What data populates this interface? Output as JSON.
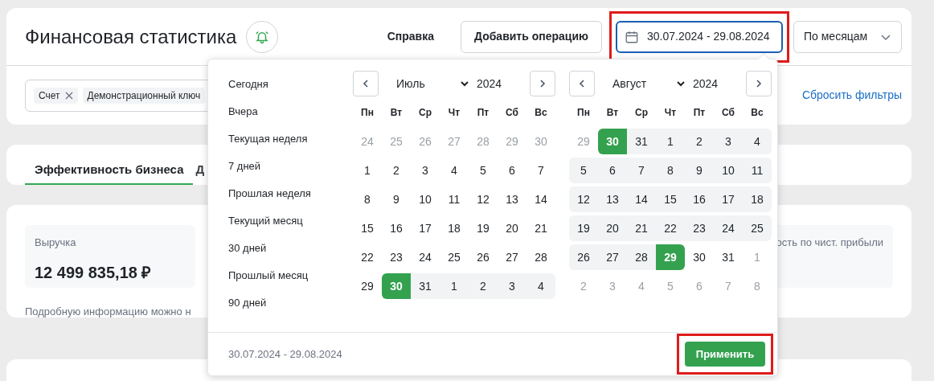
{
  "header": {
    "title": "Финансовая статистика",
    "help_link": "Справка",
    "add_button": "Добавить операцию",
    "date_field": {
      "value": "30.07.2024 - 29.08.2024",
      "focused": true,
      "highlighted": true
    },
    "grouping_select": {
      "value": "По месяцам"
    }
  },
  "filters": {
    "chips": [
      {
        "label": "Счет",
        "removable": true
      },
      {
        "label": "Демонстрационный ключ",
        "removable": false
      }
    ],
    "reset_link": "Сбросить фильтры"
  },
  "tabs": [
    {
      "label": "Эффективность бизнеса",
      "selected": true
    },
    {
      "label": "Д",
      "selected": false
    }
  ],
  "metrics": [
    {
      "label": "Выручка",
      "value": "12 499 835,18 ₽"
    },
    {
      "label": "ость по чист. прибыли"
    }
  ],
  "note": "Подробную информацию можно н",
  "date_picker": {
    "presets": [
      "Сегодня",
      "Вчера",
      "Текущая неделя",
      "7 дней",
      "Прошлая неделя",
      "Текущий месяц",
      "30 дней",
      "Прошлый месяц",
      "90 дней"
    ],
    "calendars": [
      {
        "month": "Июль",
        "year": "2024",
        "weekdays": [
          "Пн",
          "Вт",
          "Ср",
          "Чт",
          "Пт",
          "Сб",
          "Вс"
        ],
        "weeks": [
          [
            {
              "day": "24",
              "muted": true,
              "in_range": false,
              "selected": false
            },
            {
              "day": "25",
              "muted": true,
              "in_range": false,
              "selected": false
            },
            {
              "day": "26",
              "muted": true,
              "in_range": false,
              "selected": false
            },
            {
              "day": "27",
              "muted": true,
              "in_range": false,
              "selected": false
            },
            {
              "day": "28",
              "muted": true,
              "in_range": false,
              "selected": false
            },
            {
              "day": "29",
              "muted": true,
              "in_range": false,
              "selected": false
            },
            {
              "day": "30",
              "muted": true,
              "in_range": false,
              "selected": false
            }
          ],
          [
            {
              "day": "1",
              "muted": false,
              "in_range": false,
              "selected": false
            },
            {
              "day": "2",
              "muted": false,
              "in_range": false,
              "selected": false
            },
            {
              "day": "3",
              "muted": false,
              "in_range": false,
              "selected": false
            },
            {
              "day": "4",
              "muted": false,
              "in_range": false,
              "selected": false
            },
            {
              "day": "5",
              "muted": false,
              "in_range": false,
              "selected": false
            },
            {
              "day": "6",
              "muted": false,
              "in_range": false,
              "selected": false
            },
            {
              "day": "7",
              "muted": false,
              "in_range": false,
              "selected": false
            }
          ],
          [
            {
              "day": "8",
              "muted": false,
              "in_range": false,
              "selected": false
            },
            {
              "day": "9",
              "muted": false,
              "in_range": false,
              "selected": false
            },
            {
              "day": "10",
              "muted": false,
              "in_range": false,
              "selected": false
            },
            {
              "day": "11",
              "muted": false,
              "in_range": false,
              "selected": false
            },
            {
              "day": "12",
              "muted": false,
              "in_range": false,
              "selected": false
            },
            {
              "day": "13",
              "muted": false,
              "in_range": false,
              "selected": false
            },
            {
              "day": "14",
              "muted": false,
              "in_range": false,
              "selected": false
            }
          ],
          [
            {
              "day": "15",
              "muted": false,
              "in_range": false,
              "selected": false
            },
            {
              "day": "16",
              "muted": false,
              "in_range": false,
              "selected": false
            },
            {
              "day": "17",
              "muted": false,
              "in_range": false,
              "selected": false
            },
            {
              "day": "18",
              "muted": false,
              "in_range": false,
              "selected": false
            },
            {
              "day": "19",
              "muted": false,
              "in_range": false,
              "selected": false
            },
            {
              "day": "20",
              "muted": false,
              "in_range": false,
              "selected": false
            },
            {
              "day": "21",
              "muted": false,
              "in_range": false,
              "selected": false
            }
          ],
          [
            {
              "day": "22",
              "muted": false,
              "in_range": false,
              "selected": false
            },
            {
              "day": "23",
              "muted": false,
              "in_range": false,
              "selected": false
            },
            {
              "day": "24",
              "muted": false,
              "in_range": false,
              "selected": false
            },
            {
              "day": "25",
              "muted": false,
              "in_range": false,
              "selected": false
            },
            {
              "day": "26",
              "muted": false,
              "in_range": false,
              "selected": false
            },
            {
              "day": "27",
              "muted": false,
              "in_range": false,
              "selected": false
            },
            {
              "day": "28",
              "muted": false,
              "in_range": false,
              "selected": false
            }
          ],
          [
            {
              "day": "29",
              "muted": false,
              "in_range": false,
              "selected": false
            },
            {
              "day": "30",
              "muted": false,
              "in_range": false,
              "selected": true
            },
            {
              "day": "31",
              "muted": false,
              "in_range": true,
              "selected": false
            },
            {
              "day": "1",
              "muted": false,
              "in_range": true,
              "selected": false
            },
            {
              "day": "2",
              "muted": false,
              "in_range": true,
              "selected": false
            },
            {
              "day": "3",
              "muted": false,
              "in_range": true,
              "selected": false
            },
            {
              "day": "4",
              "muted": false,
              "in_range": true,
              "selected": false
            }
          ]
        ]
      },
      {
        "month": "Август",
        "year": "2024",
        "weekdays": [
          "Пн",
          "Вт",
          "Ср",
          "Чт",
          "Пт",
          "Сб",
          "Вс"
        ],
        "weeks": [
          [
            {
              "day": "29",
              "muted": true,
              "in_range": false,
              "selected": false
            },
            {
              "day": "30",
              "muted": false,
              "in_range": false,
              "selected": true
            },
            {
              "day": "31",
              "muted": false,
              "in_range": true,
              "selected": false
            },
            {
              "day": "1",
              "muted": false,
              "in_range": true,
              "selected": false
            },
            {
              "day": "2",
              "muted": false,
              "in_range": true,
              "selected": false
            },
            {
              "day": "3",
              "muted": false,
              "in_range": true,
              "selected": false
            },
            {
              "day": "4",
              "muted": false,
              "in_range": true,
              "selected": false
            }
          ],
          [
            {
              "day": "5",
              "muted": false,
              "in_range": true,
              "selected": false
            },
            {
              "day": "6",
              "muted": false,
              "in_range": true,
              "selected": false
            },
            {
              "day": "7",
              "muted": false,
              "in_range": true,
              "selected": false
            },
            {
              "day": "8",
              "muted": false,
              "in_range": true,
              "selected": false
            },
            {
              "day": "9",
              "muted": false,
              "in_range": true,
              "selected": false
            },
            {
              "day": "10",
              "muted": false,
              "in_range": true,
              "selected": false
            },
            {
              "day": "11",
              "muted": false,
              "in_range": true,
              "selected": false
            }
          ],
          [
            {
              "day": "12",
              "muted": false,
              "in_range": true,
              "selected": false
            },
            {
              "day": "13",
              "muted": false,
              "in_range": true,
              "selected": false
            },
            {
              "day": "14",
              "muted": false,
              "in_range": true,
              "selected": false
            },
            {
              "day": "15",
              "muted": false,
              "in_range": true,
              "selected": false
            },
            {
              "day": "16",
              "muted": false,
              "in_range": true,
              "selected": false
            },
            {
              "day": "17",
              "muted": false,
              "in_range": true,
              "selected": false
            },
            {
              "day": "18",
              "muted": false,
              "in_range": true,
              "selected": false
            }
          ],
          [
            {
              "day": "19",
              "muted": false,
              "in_range": true,
              "selected": false
            },
            {
              "day": "20",
              "muted": false,
              "in_range": true,
              "selected": false
            },
            {
              "day": "21",
              "muted": false,
              "in_range": true,
              "selected": false
            },
            {
              "day": "22",
              "muted": false,
              "in_range": true,
              "selected": false
            },
            {
              "day": "23",
              "muted": false,
              "in_range": true,
              "selected": false
            },
            {
              "day": "24",
              "muted": false,
              "in_range": true,
              "selected": false
            },
            {
              "day": "25",
              "muted": false,
              "in_range": true,
              "selected": false
            }
          ],
          [
            {
              "day": "26",
              "muted": false,
              "in_range": true,
              "selected": false
            },
            {
              "day": "27",
              "muted": false,
              "in_range": true,
              "selected": false
            },
            {
              "day": "28",
              "muted": false,
              "in_range": true,
              "selected": false
            },
            {
              "day": "29",
              "muted": false,
              "in_range": false,
              "selected": true
            },
            {
              "day": "30",
              "muted": false,
              "in_range": false,
              "selected": false
            },
            {
              "day": "31",
              "muted": false,
              "in_range": false,
              "selected": false
            },
            {
              "day": "1",
              "muted": true,
              "in_range": false,
              "selected": false
            }
          ],
          [
            {
              "day": "2",
              "muted": true,
              "in_range": false,
              "selected": false
            },
            {
              "day": "3",
              "muted": true,
              "in_range": false,
              "selected": false
            },
            {
              "day": "4",
              "muted": true,
              "in_range": false,
              "selected": false
            },
            {
              "day": "5",
              "muted": true,
              "in_range": false,
              "selected": false
            },
            {
              "day": "6",
              "muted": true,
              "in_range": false,
              "selected": false
            },
            {
              "day": "7",
              "muted": true,
              "in_range": false,
              "selected": false
            },
            {
              "day": "8",
              "muted": true,
              "in_range": false,
              "selected": false
            }
          ]
        ]
      }
    ],
    "range_text": "30.07.2024 - 29.08.2024",
    "apply_button": "Применить",
    "apply_highlighted": true
  }
}
